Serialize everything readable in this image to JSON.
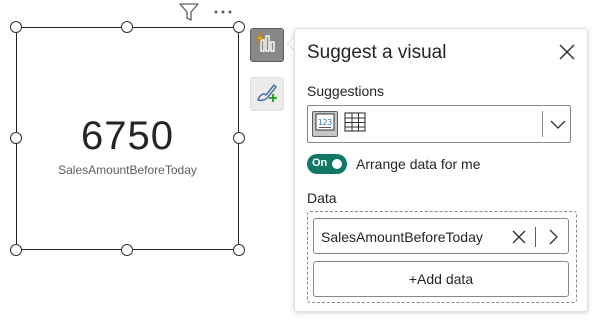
{
  "visual": {
    "card_value": "6750",
    "card_label": "SalesAmountBeforeToday",
    "toolbar_icons": [
      "filter-icon",
      "more-options-icon"
    ]
  },
  "side_buttons": [
    {
      "icon": "suggest-visual-icon",
      "state": "active"
    },
    {
      "icon": "format-visual-icon",
      "state": "inactive"
    }
  ],
  "panel": {
    "title": "Suggest a visual",
    "suggestions_label": "Suggestions",
    "suggestion_options": [
      {
        "icon": "card-chart-icon",
        "selected": true
      },
      {
        "icon": "table-chart-icon",
        "selected": false
      }
    ],
    "arrange_toggle": {
      "state_text": "On",
      "label": "Arrange data for me",
      "on": true
    },
    "data_label": "Data",
    "fields": [
      {
        "name": "SalesAmountBeforeToday"
      }
    ],
    "add_data_label": "+Add data"
  },
  "colors": {
    "toggle_on": "#117865",
    "active_button": "#8a8886",
    "lightning": "#f2b100"
  }
}
